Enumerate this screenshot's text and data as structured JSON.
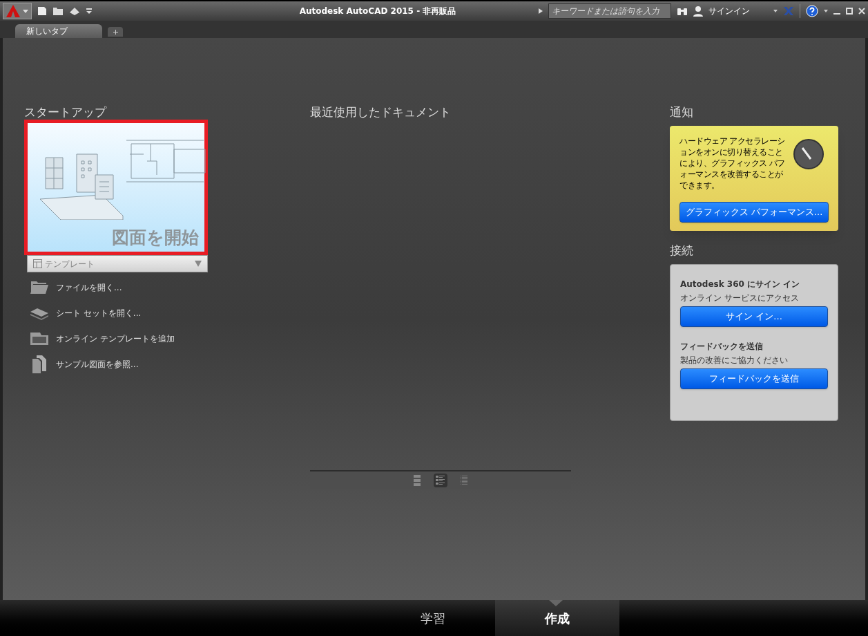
{
  "title_bar": {
    "title": "Autodesk AutoCAD 2015 - 非再販品",
    "search_placeholder": "キーワードまたは語句を入力",
    "user": "サインイン"
  },
  "tabs": [
    {
      "label": "新しいタブ",
      "selected": true
    }
  ],
  "startup": {
    "heading": "スタートアップ",
    "tile_label": "図面を開始",
    "template": "テンプレート",
    "actions": [
      {
        "kind": "folder",
        "label": "ファイルを開く..."
      },
      {
        "kind": "sheets",
        "label": "シート セットを開く..."
      },
      {
        "kind": "online",
        "label": "オンライン テンプレートを追加"
      },
      {
        "kind": "sample",
        "label": "サンプル図面を参照..."
      }
    ]
  },
  "recent": {
    "heading": "最近使用したドキュメント",
    "view_modes": [
      {
        "kind": "large",
        "selected": false
      },
      {
        "kind": "detail",
        "selected": true
      },
      {
        "kind": "list",
        "selected": false
      }
    ]
  },
  "notifications": {
    "heading": "通知",
    "message": "ハードウェア アクセラレーションをオンに切り替えることにより、グラフィックス パフォーマンスを改善することができます。",
    "button": "グラフィックス パフォーマンス..."
  },
  "connect": {
    "heading": "接続",
    "sections": [
      {
        "title": "Autodesk 360 にサイン イン",
        "subtitle": "オンライン サービスにアクセス",
        "button": "サイン イン..."
      },
      {
        "title": "フィードバックを送信",
        "subtitle": "製品の改善にご協力ください",
        "button": "フィードバックを送信"
      }
    ]
  },
  "bottom_tabs": [
    {
      "label": "学習",
      "selected": false
    },
    {
      "label": "作成",
      "selected": true
    }
  ]
}
